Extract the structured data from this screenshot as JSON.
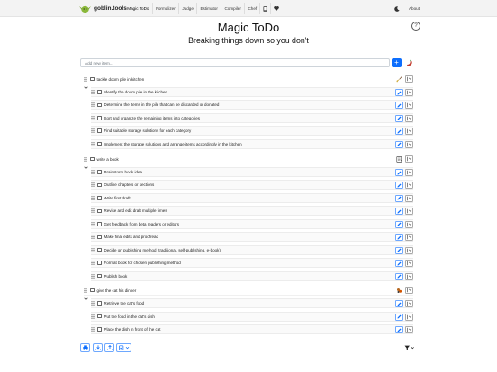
{
  "navbar": {
    "brand": "goblin.tools",
    "links": [
      "Magic ToDo",
      "Formalizer",
      "Judge",
      "Estimator",
      "Compiler",
      "Chef"
    ],
    "about": "About",
    "icons": [
      "mobile-icon",
      "heart-icon",
      "moon-icon"
    ]
  },
  "header": {
    "title": "Magic ToDo",
    "subtitle": "Breaking things down so you don't",
    "help": "?"
  },
  "add": {
    "placeholder": "Add new item...",
    "add_label": "+"
  },
  "tasks": [
    {
      "label": "tackle doom pile in kitchen",
      "subtasks": [
        "Identify the doom pile in the kitchen",
        "Determine the items in the pile that can be discarded or donated",
        "Sort and organize the remaining items into categories",
        "Find suitable storage solutions for each category",
        "Implement the storage solutions and arrange items accordingly in the kitchen"
      ]
    },
    {
      "label": "write a book",
      "subtasks": [
        "Brainstorm book idea",
        "Outline chapters or sections",
        "Write first draft",
        "Revise and edit draft multiple times",
        "Get feedback from beta readers or editors",
        "Make final edits and proofread",
        "Decide on publishing method (traditional, self-publishing, e-book)",
        "Format book for chosen publishing method",
        "Publish book"
      ]
    },
    {
      "label": "give the cat his dinner",
      "subtasks": [
        "Retrieve the cat's food",
        "Put the food in the cat's dish",
        "Place the dish in front of the cat"
      ]
    }
  ],
  "colors": {
    "primary": "#0d6efd",
    "primary_light": "#6ea8fe",
    "navbar_bg": "#f3f3f3",
    "brand_green": "#8ab83a"
  }
}
